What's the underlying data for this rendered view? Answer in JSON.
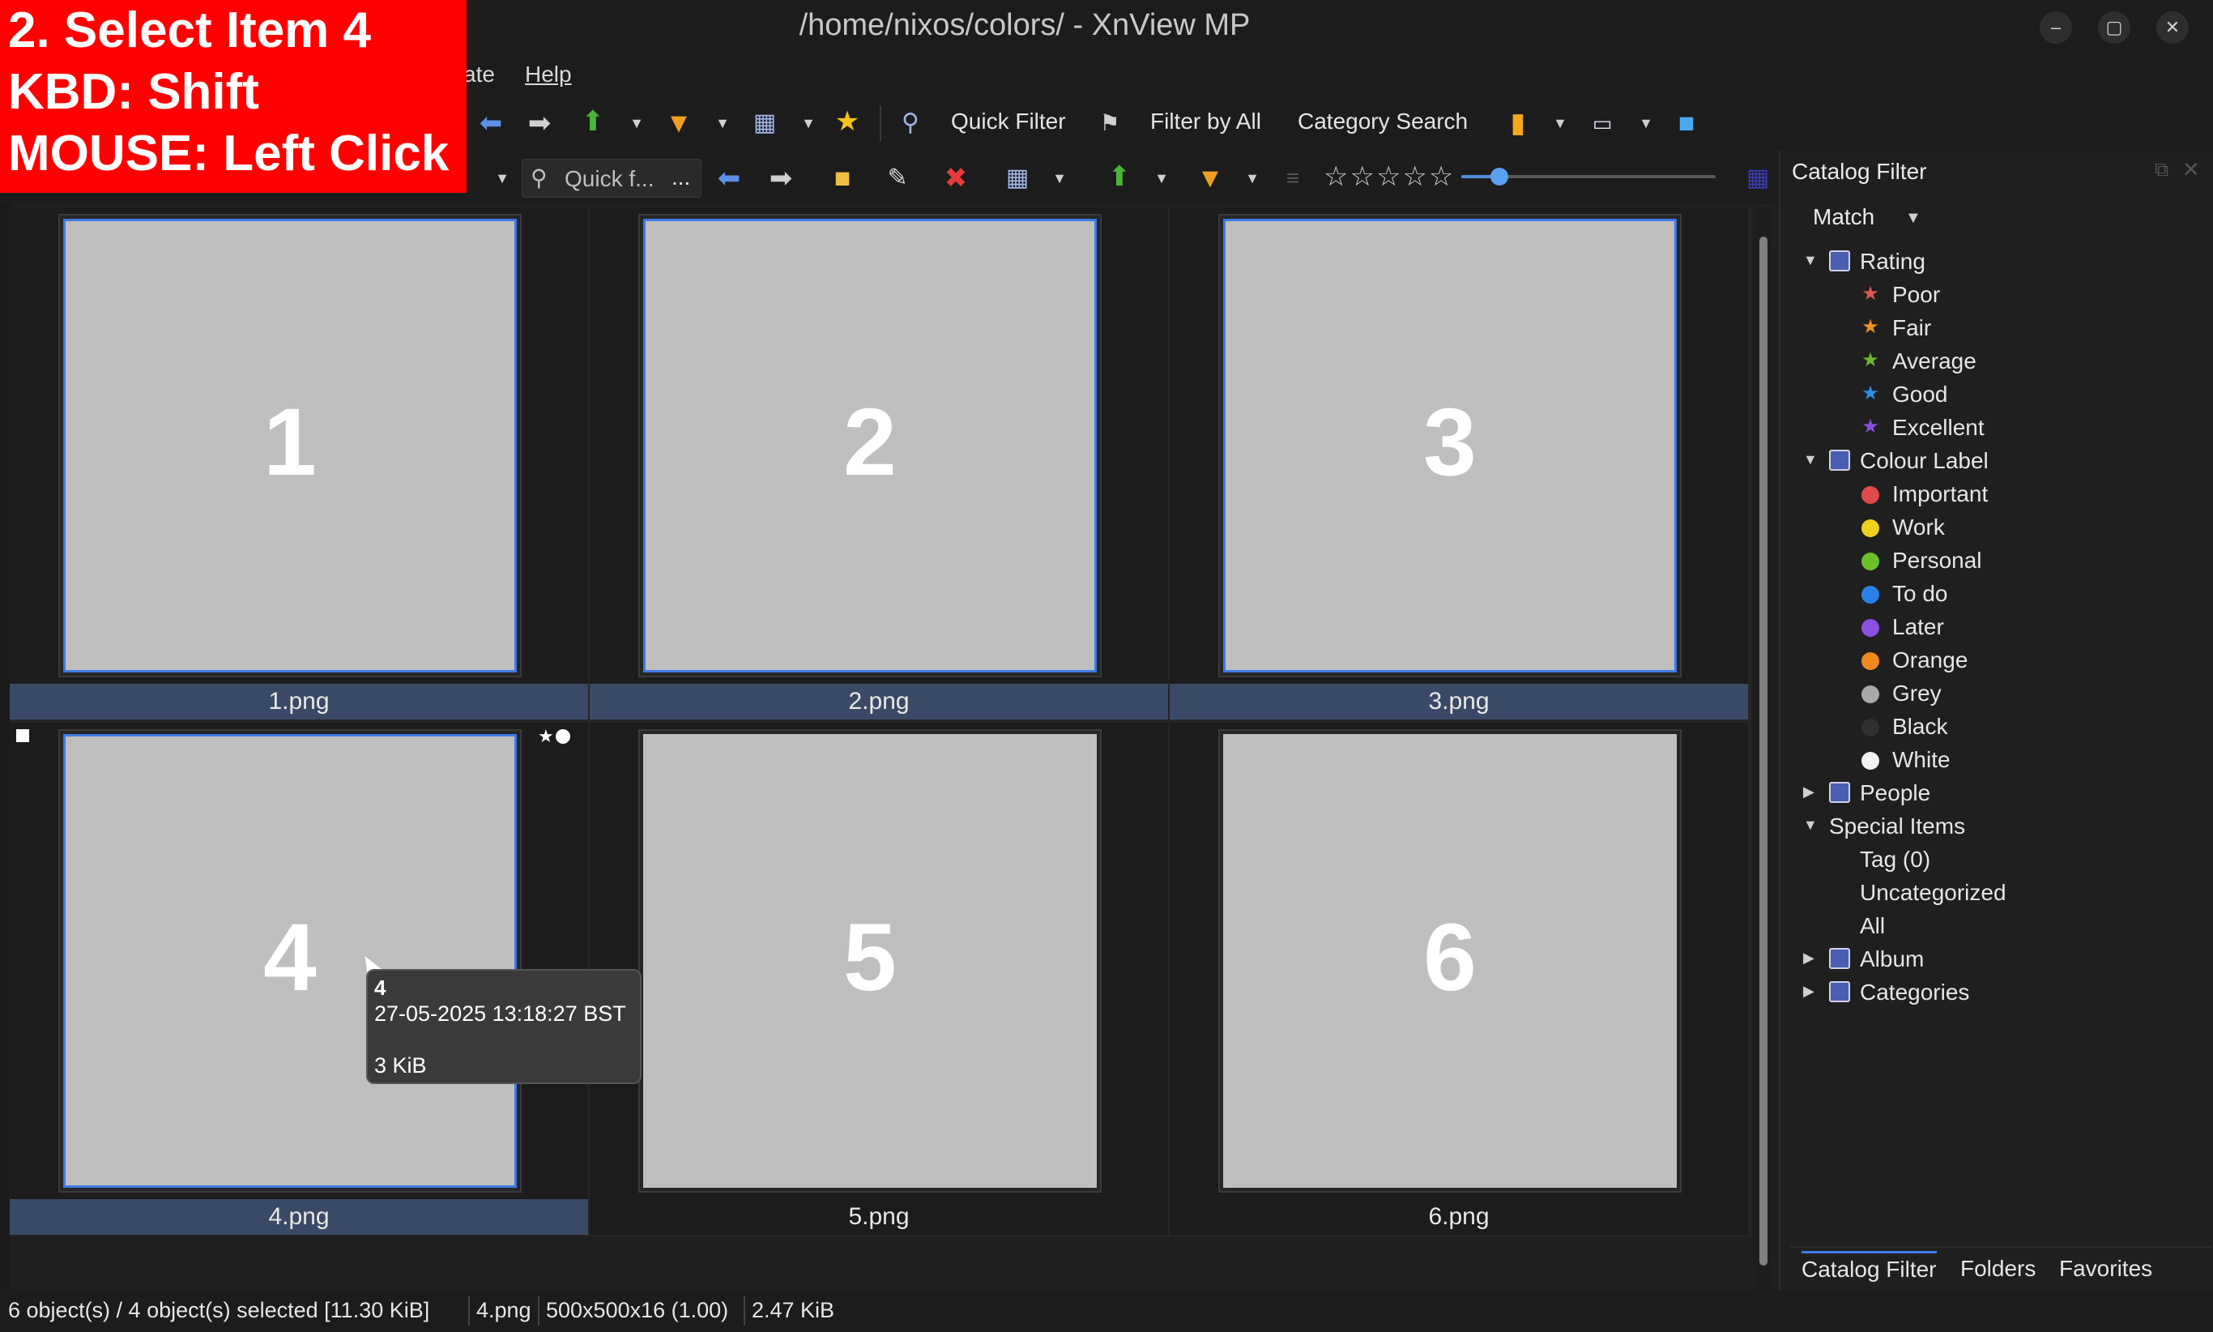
{
  "window": {
    "title": "/home/nixos/colors/ - XnView MP",
    "controls": [
      "–",
      "▢",
      "✕"
    ]
  },
  "menu": {
    "items": [
      "ate",
      "Help"
    ]
  },
  "toolbar1": {
    "quick_filter": "Quick Filter",
    "filter_by_all": "Filter by All",
    "category_search": "Category Search"
  },
  "toolbar2": {
    "quick_filter_placeholder": "Quick f...",
    "more": "...",
    "rating_stars": "☆☆☆☆☆",
    "thumb_size_level": 0.15
  },
  "thumbnails": [
    {
      "number": "1",
      "label": "1.png",
      "selected": true
    },
    {
      "number": "2",
      "label": "2.png",
      "selected": true
    },
    {
      "number": "3",
      "label": "3.png",
      "selected": true
    },
    {
      "number": "4",
      "label": "4.png",
      "selected": true
    },
    {
      "number": "5",
      "label": "5.png",
      "selected": false
    },
    {
      "number": "6",
      "label": "6.png",
      "selected": false
    }
  ],
  "tooltip": {
    "name": "4",
    "date": "27-05-2025 13:18:27 BST",
    "size": "3 KiB"
  },
  "catalog_panel": {
    "title": "Catalog Filter",
    "match_label": "Match",
    "rating": {
      "label": "Rating",
      "items": [
        {
          "label": "Poor",
          "color": "#e05555"
        },
        {
          "label": "Fair",
          "color": "#f0901e"
        },
        {
          "label": "Average",
          "color": "#6dbb2d"
        },
        {
          "label": "Good",
          "color": "#2f8fe8"
        },
        {
          "label": "Excellent",
          "color": "#8a4fe0"
        }
      ]
    },
    "colour_label": {
      "label": "Colour Label",
      "items": [
        {
          "label": "Important",
          "color": "#e04a4a"
        },
        {
          "label": "Work",
          "color": "#f0d020"
        },
        {
          "label": "Personal",
          "color": "#6cbf2a"
        },
        {
          "label": "To do",
          "color": "#2a80e8"
        },
        {
          "label": "Later",
          "color": "#8c50e0"
        },
        {
          "label": "Orange",
          "color": "#f08a20"
        },
        {
          "label": "Grey",
          "color": "#a8a8a8"
        },
        {
          "label": "Black",
          "color": "#303030"
        },
        {
          "label": "White",
          "color": "#f2f2f2"
        }
      ]
    },
    "people": "People",
    "special_items": {
      "label": "Special Items",
      "items": [
        "Tag (0)",
        "Uncategorized",
        "All"
      ]
    },
    "album": "Album",
    "categories": "Categories",
    "tabs": [
      "Catalog Filter",
      "Folders",
      "Favorites"
    ]
  },
  "statusbar": {
    "objects": "6 object(s) / 4 object(s) selected [11.30 KiB]",
    "file": "4.png",
    "dims": "500x500x16 (1.00)",
    "size": "2.47 KiB"
  },
  "overlay": {
    "line1": "2. Select Item 4",
    "line2": "KBD: Shift",
    "line3": "MOUSE: Left Click"
  }
}
